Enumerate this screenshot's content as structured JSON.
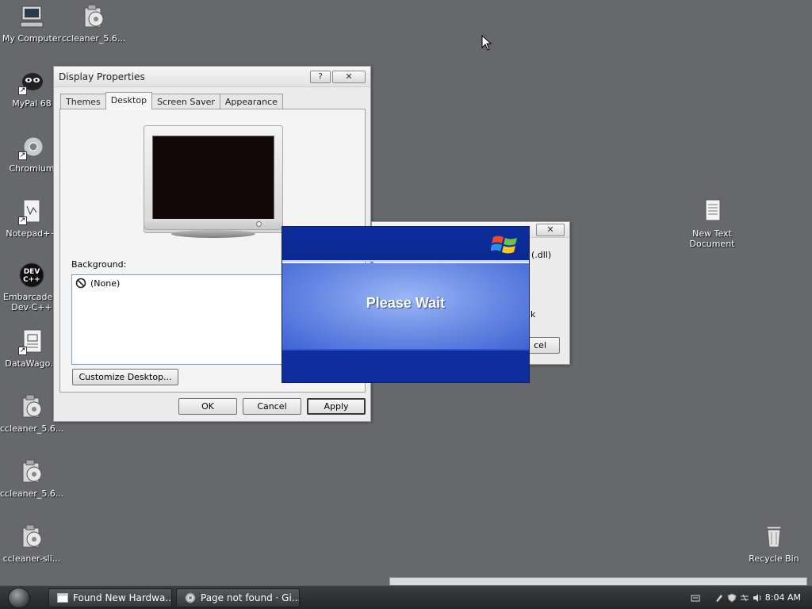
{
  "desktop": {
    "icons": [
      {
        "id": "my-computer",
        "label": "My Computer"
      },
      {
        "id": "ccleaner-top",
        "label": "ccleaner_5.6..."
      },
      {
        "id": "mypal",
        "label": "MyPal 68"
      },
      {
        "id": "chromium",
        "label": "Chromium"
      },
      {
        "id": "notepadpp",
        "label": "Notepad++"
      },
      {
        "id": "devcpp",
        "label": "Embarcadero Dev-C++"
      },
      {
        "id": "datawago",
        "label": "DataWago..."
      },
      {
        "id": "ccleaner-2",
        "label": "ccleaner_5.6..."
      },
      {
        "id": "ccleaner-3",
        "label": "ccleaner_5.6..."
      },
      {
        "id": "ccleaner-slim",
        "label": "ccleaner-sli..."
      },
      {
        "id": "new-text-doc",
        "label": "New Text Document"
      },
      {
        "id": "recycle-bin",
        "label": "Recycle Bin"
      }
    ],
    "devcpp_badge": "DEV\nC++"
  },
  "display_properties": {
    "title": "Display Properties",
    "help_btn": "?",
    "close_btn": "✕",
    "tabs": [
      "Themes",
      "Desktop",
      "Screen Saver",
      "Appearance"
    ],
    "active_tab": "Desktop",
    "background_label": "Background:",
    "background_items": [
      {
        "label": "(None)",
        "icon": "none-icon"
      }
    ],
    "customize_btn": "Customize Desktop...",
    "ok_btn": "OK",
    "cancel_btn": "Cancel",
    "apply_btn": "Apply"
  },
  "background_dialog": {
    "close_btn": "✕",
    "partial_text_1": "(.dll)",
    "partial_text_2": "k",
    "partial_button": "cel"
  },
  "splash": {
    "message": "Please Wait"
  },
  "taskbar": {
    "tasks": [
      {
        "label": "Found New Hardwa...",
        "icon": "window-icon"
      },
      {
        "label": "Page not found · Gi...",
        "icon": "chromium-icon"
      }
    ],
    "clock": "8:04 AM"
  },
  "colors": {
    "desktop_bg": "#66686b",
    "splash_blue": "#0c2d9e",
    "taskbar": "#2b2c2e"
  }
}
